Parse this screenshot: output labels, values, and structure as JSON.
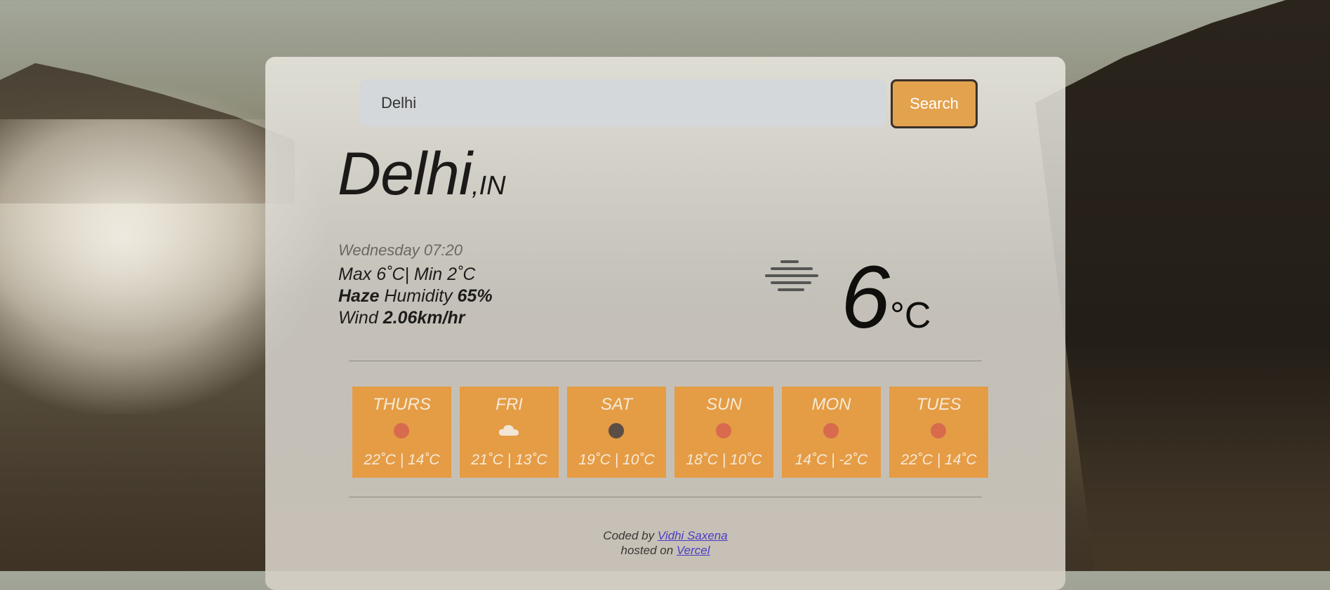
{
  "search": {
    "value": "Delhi",
    "button_label": "Search"
  },
  "location": {
    "city": "Delhi",
    "country": ",IN"
  },
  "current": {
    "datetime": "Wednesday 07:20",
    "max_label": "Max",
    "max_value": "6˚C|",
    "min_label": "Min",
    "min_value": "2˚C",
    "condition": "Haze",
    "humidity_label": "Humidity",
    "humidity_value": "65%",
    "wind_label": "Wind",
    "wind_value": "2.06km/hr",
    "temperature": "6",
    "unit": "°C",
    "icon": "haze-icon"
  },
  "forecast": [
    {
      "day": "THURS",
      "icon": "sun-icon",
      "temps": "22˚C | 14˚C"
    },
    {
      "day": "FRI",
      "icon": "cloud-icon",
      "temps": "21˚C | 13˚C"
    },
    {
      "day": "SAT",
      "icon": "moon-icon",
      "temps": "19˚C | 10˚C"
    },
    {
      "day": "SUN",
      "icon": "sun-icon",
      "temps": "18˚C | 10˚C"
    },
    {
      "day": "MON",
      "icon": "sun-icon",
      "temps": "14˚C | -2˚C"
    },
    {
      "day": "TUES",
      "icon": "sun-icon",
      "temps": "22˚C | 14˚C"
    }
  ],
  "footer": {
    "coded_by": "Coded by",
    "author": "Vidhi Saxena",
    "hosted_on": "hosted on",
    "host": "Vercel"
  },
  "colors": {
    "accent": "#e3a24e",
    "forecast_card": "#e89838"
  }
}
